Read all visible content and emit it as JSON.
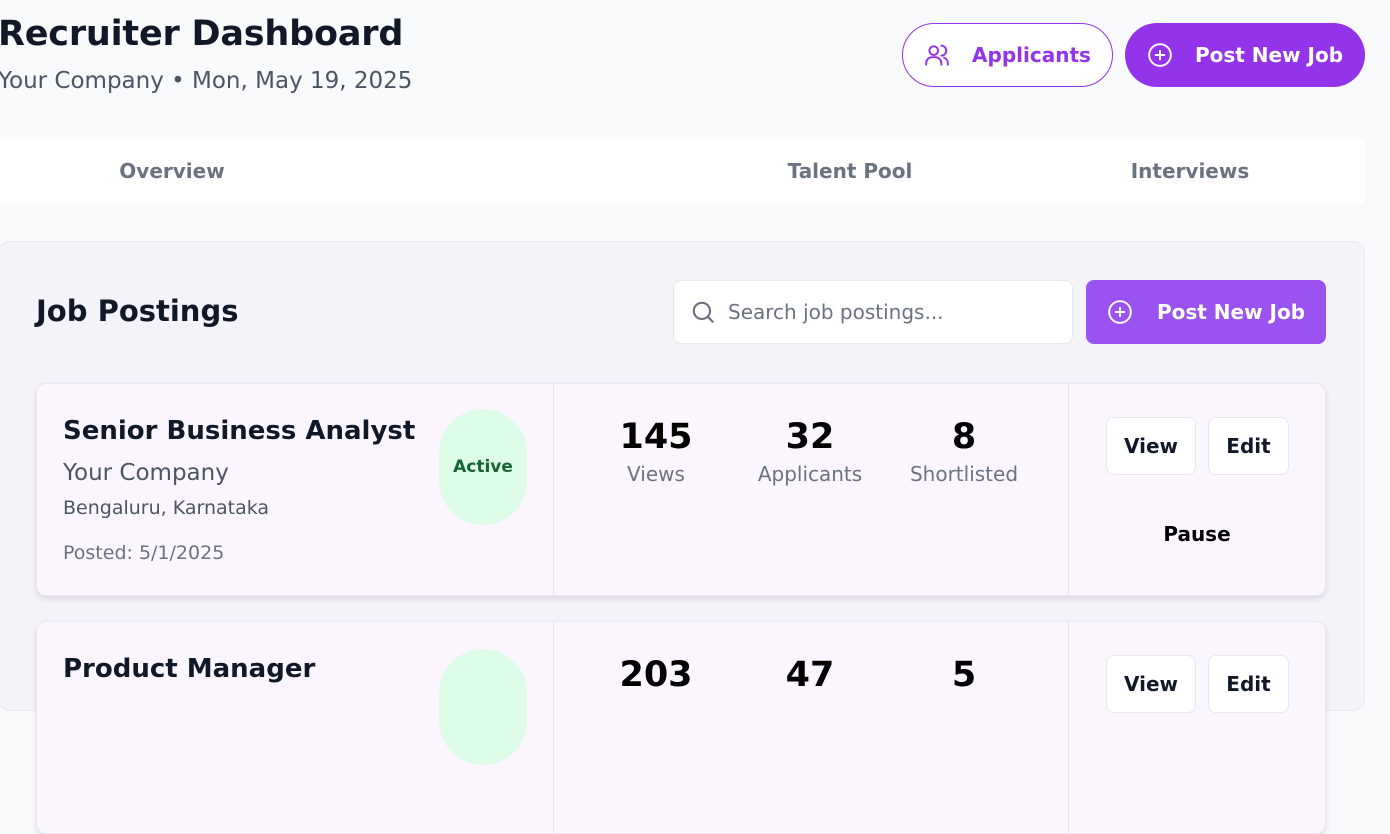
{
  "header": {
    "title": "Recruiter Dashboard",
    "subtitle": "Your Company • Mon, May 19, 2025",
    "applicants_label": "Applicants",
    "post_job_label": "Post New Job"
  },
  "tabs": [
    {
      "label": "Overview"
    },
    {
      "label": "Talent Pool"
    },
    {
      "label": "Interviews"
    }
  ],
  "postings": {
    "title": "Job Postings",
    "search_placeholder": "Search job postings...",
    "post_job_label": "Post New Job",
    "jobs": [
      {
        "title": "Senior Business Analyst",
        "company": "Your Company",
        "location": "Bengaluru, Karnataka",
        "posted": "Posted: 5/1/2025",
        "status": "Active",
        "views": "145",
        "views_label": "Views",
        "applicants": "32",
        "applicants_label": "Applicants",
        "shortlisted": "8",
        "shortlisted_label": "Shortlisted",
        "view_label": "View",
        "edit_label": "Edit",
        "pause_label": "Pause"
      },
      {
        "title": "Product Manager",
        "views": "203",
        "applicants": "47",
        "shortlisted": "5",
        "view_label": "View",
        "edit_label": "Edit"
      }
    ]
  },
  "colors": {
    "accent": "#9333ea",
    "accent_light": "#9a52f0",
    "status_active_bg": "#dcfce7",
    "status_active_text": "#166534"
  }
}
